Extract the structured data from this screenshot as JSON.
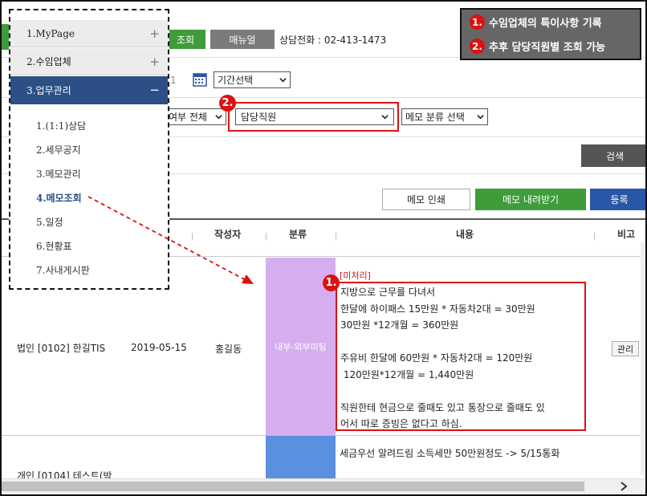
{
  "toolbar": {
    "search_btn": "조회",
    "manual_btn": "매뉴얼",
    "phone_text": "상담전화 : 02-413-1473"
  },
  "filters": {
    "date_fragment": "1",
    "period_select": "기간선택",
    "status_select": "여부 전체",
    "staff_select": "담당직원",
    "category_select": "메모 분류 선택",
    "search_button": "검색"
  },
  "actions": {
    "print": "메모 인쇄",
    "download": "메모 내려받기",
    "register": "등록"
  },
  "table": {
    "headers": {
      "writer": "작성자",
      "category": "분류",
      "content": "내용",
      "note": "비고"
    },
    "rows": [
      {
        "company": "법인 [0102] 한길TIS",
        "date": "2019-05-15",
        "writer": "홍길동",
        "category": "내부-외부미팅",
        "status": "[미처리]",
        "content_lines": [
          "지방으로 근무를 다녀서",
          "한달에 하이패스 15만원 * 자동차2대 = 30만원",
          "30만원 *12개월 = 360만원",
          "",
          "주유비 한달에 60만원 * 자동차2대 = 120만원",
          " 120만원*12개월 = 1,440만원",
          "",
          "직원한테 현금으로 줄때도 있고 통장으로 줄때도 있",
          "어서 따로 증빙은 없다고 하심."
        ],
        "manage_btn": "관리"
      },
      {
        "company": "개인 [0104] 테스트(박",
        "content": "세금우선 알려드림 소득세만 50만원정도 -> 5/15통화"
      }
    ]
  },
  "sidebar": {
    "sections": [
      {
        "label": "1.MyPage",
        "toggle": "+"
      },
      {
        "label": "2.수임업체",
        "toggle": "+"
      },
      {
        "label": "3.업무관리",
        "toggle": "−"
      }
    ],
    "items": [
      "1.(1:1)상담",
      "2.세무공지",
      "3.메모관리",
      "4.메모조회",
      "5.일정",
      "6.현황표",
      "7.사내게시판"
    ],
    "active_item": "4.메모조회"
  },
  "callouts": {
    "num1": "1.",
    "num2": "2.",
    "text1": "수임업체의 특이사항 기록",
    "text2": "추후 담당직원별 조회 가능"
  },
  "colors": {
    "sidebar_active": "#2c4f86",
    "download_green": "#3f9c3a",
    "register_blue": "#2a56a8",
    "category_purple": "#d6aef0",
    "category_blue": "#5b8fe0",
    "callout_red": "#d11111"
  }
}
